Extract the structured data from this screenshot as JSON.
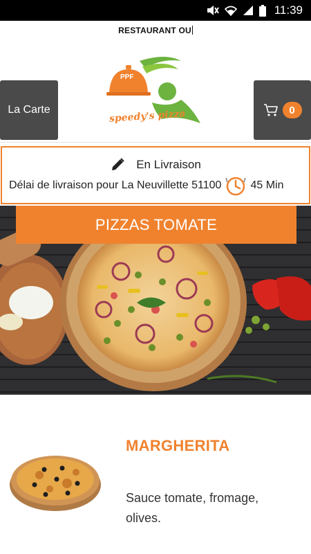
{
  "status_bar": {
    "time": "11:39"
  },
  "header": {
    "title": "RESTAURANT OU"
  },
  "nav": {
    "menu_label": "La Carte"
  },
  "cart": {
    "count": "0"
  },
  "logo": {
    "text": "speedy's pizza",
    "badge": "PPF"
  },
  "delivery": {
    "mode": "En Livraison",
    "info": "Délai de livraison pour La Neuvillette 51100",
    "time": "45 Min"
  },
  "category": {
    "title": "PIZZAS TOMATE"
  },
  "products": [
    {
      "name": "MARGHERITA",
      "description": "Sauce tomate, fromage, olives."
    }
  ],
  "colors": {
    "accent": "#f0822e",
    "button_bg": "#4a4a4a",
    "logo_green": "#6cb33f"
  },
  "icons": [
    "mute-icon",
    "wifi-icon",
    "signal-icon",
    "battery-icon",
    "cart-icon",
    "pencil-icon",
    "delivery-clock-icon"
  ]
}
